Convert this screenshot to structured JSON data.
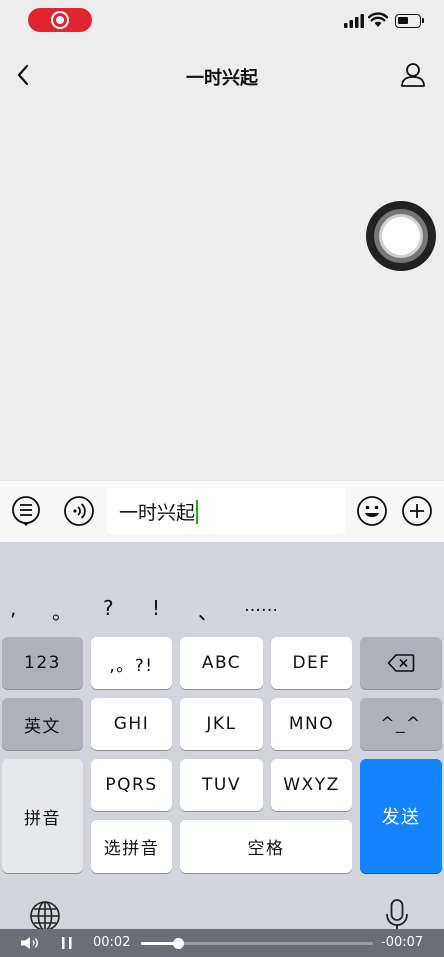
{
  "status_bar": {
    "battery_level": 0.5
  },
  "nav": {
    "title": "一时兴起",
    "back_icon": "chevron-left-icon",
    "profile_icon": "person-icon"
  },
  "input_bar": {
    "text": "一时兴起",
    "menu_icon": "list-menu-icon",
    "voice_icon": "voice-icon",
    "emoji_icon": "emoji-icon",
    "add_icon": "plus-icon"
  },
  "keyboard": {
    "punctuation": [
      ",",
      "。",
      "?",
      "!",
      "、",
      "……"
    ],
    "keys": {
      "num": "123",
      "punct": ",。?!",
      "abc": "ABC",
      "def": "DEF",
      "english": "英文",
      "ghi": "GHI",
      "jkl": "JKL",
      "mno": "MNO",
      "emoticon": "^_^",
      "pinyin": "拼音",
      "pqrs": "PQRS",
      "tuv": "TUV",
      "wxyz": "WXYZ",
      "send": "发送",
      "select_pinyin": "选拼音",
      "space": "空格"
    },
    "accent_color": "#1484ff"
  },
  "video_bar": {
    "elapsed": "00:02",
    "remaining": "-00:07",
    "progress": 0.16
  }
}
